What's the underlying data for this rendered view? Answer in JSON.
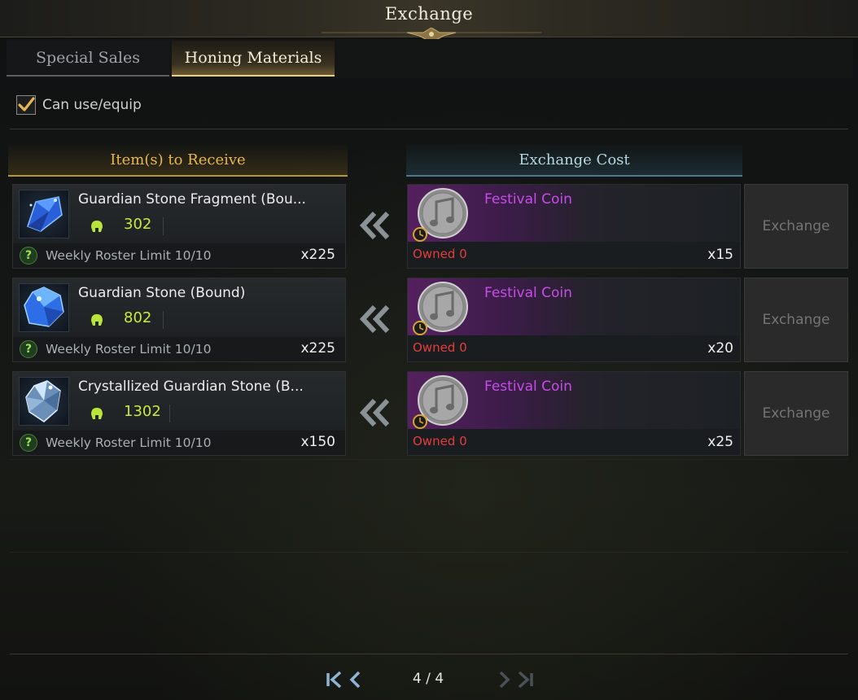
{
  "window": {
    "title": "Exchange"
  },
  "tabs": [
    {
      "label": "Special Sales",
      "active": false
    },
    {
      "label": "Honing Materials",
      "active": true
    }
  ],
  "filter": {
    "label": "Can use/equip",
    "checked": true
  },
  "columns": {
    "receive": "Item(s) to Receive",
    "cost": "Exchange Cost"
  },
  "rows": [
    {
      "item_name": "Guardian Stone Fragment (Bou...",
      "item_icon": "guardian-stone-fragment-icon",
      "item_level": "302",
      "limit": "Weekly Roster Limit 10/10",
      "receive_qty": "x225",
      "cost_name": "Festival Coin",
      "cost_icon": "festival-coin-icon",
      "owned": "Owned 0",
      "cost_qty": "x15",
      "button": "Exchange"
    },
    {
      "item_name": "Guardian Stone (Bound)",
      "item_icon": "guardian-stone-icon",
      "item_level": "802",
      "limit": "Weekly Roster Limit 10/10",
      "receive_qty": "x225",
      "cost_name": "Festival Coin",
      "cost_icon": "festival-coin-icon",
      "owned": "Owned 0",
      "cost_qty": "x20",
      "button": "Exchange"
    },
    {
      "item_name": "Crystallized Guardian Stone (B...",
      "item_icon": "crystallized-guardian-stone-icon",
      "item_level": "1302",
      "limit": "Weekly Roster Limit 10/10",
      "receive_qty": "x150",
      "cost_name": "Festival Coin",
      "cost_icon": "festival-coin-icon",
      "owned": "Owned 0",
      "cost_qty": "x25",
      "button": "Exchange"
    }
  ],
  "pagination": {
    "text": "4 / 4"
  },
  "colors": {
    "accent_gold": "#e8b84c",
    "cost_header": "#b6d6e0",
    "item_level": "#c8ea3c",
    "coin_name": "#c64ee6",
    "owned_warning": "#e53d3d"
  }
}
